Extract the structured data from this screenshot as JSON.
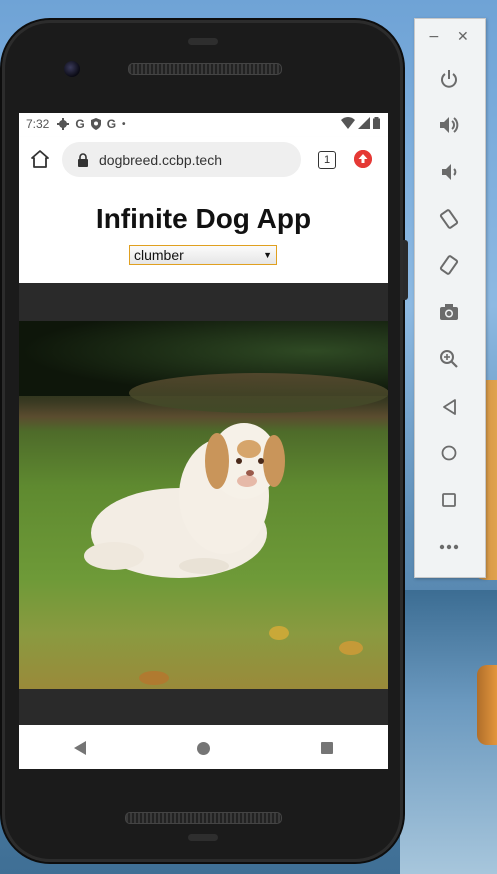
{
  "status_bar": {
    "time": "7:32",
    "left_icons": [
      "gear-icon",
      "google-icon",
      "shield-icon",
      "google-icon",
      "dot-icon"
    ],
    "right_icons": [
      "wifi-icon",
      "signal-icon",
      "battery-icon"
    ]
  },
  "browser": {
    "url": "dogbreed.ccbp.tech",
    "tab_count": "1"
  },
  "page": {
    "title": "Infinite Dog App",
    "breed_select": {
      "selected": "clumber"
    },
    "image_alt": "clumber spaniel sitting on grass"
  },
  "colors": {
    "select_border": "#e0a020",
    "update_badge": "#e53935",
    "image_frame": "#2a2a2a"
  },
  "emulator_panel": {
    "window_controls": [
      "minimize-icon",
      "close-icon"
    ],
    "buttons": [
      "power-icon",
      "volume-up-icon",
      "volume-down-icon",
      "rotate-left-icon",
      "rotate-right-icon",
      "camera-icon",
      "zoom-icon",
      "back-icon",
      "home-icon",
      "overview-icon",
      "more-icon"
    ]
  }
}
